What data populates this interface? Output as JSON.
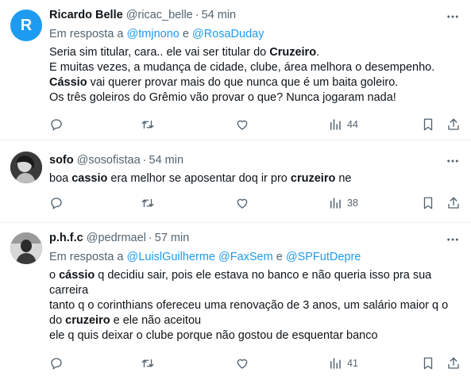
{
  "tweets": [
    {
      "avatar_letter": "R",
      "name": "Ricardo Belle",
      "handle": "@ricac_belle",
      "time": "54 min",
      "reply_prefix": "Em resposta a",
      "reply_mentions": [
        "@tmjnono",
        "@RosaDuday"
      ],
      "reply_joiner": "e",
      "lines": [
        [
          "Seria sim titular, cara.. ele vai ser titular do ",
          "Cruzeiro",
          "."
        ],
        [
          "E muitas vezes, a mudança de cidade, clube, área melhora o desempenho."
        ],
        [
          "",
          "Cássio",
          " vai querer provar mais do que nunca que é um baita goleiro."
        ],
        [
          "Os três goleiros do Grêmio vão provar o que? Nunca jogaram nada!"
        ]
      ],
      "views": "44"
    },
    {
      "name": "sofo",
      "handle": "@sosofistaa",
      "time": "54 min",
      "lines": [
        [
          "boa ",
          "cassio",
          " era melhor se aposentar doq ir pro ",
          "cruzeiro",
          " ne"
        ]
      ],
      "views": "38"
    },
    {
      "name": "p.h.f.c",
      "handle": "@pedrmael",
      "time": "57 min",
      "reply_prefix": "Em resposta a",
      "reply_mentions": [
        "@LuislGuilherme",
        "@FaxSem",
        "@SPFutDepre"
      ],
      "reply_joiner": "e",
      "lines": [
        [
          "o ",
          "cássio",
          " q decidiu sair, pois ele estava no banco e não queria isso pra sua"
        ],
        [
          "carreira"
        ],
        [
          "tanto q o corinthians ofereceu uma renovação de 3 anos, um salário maior q o"
        ],
        [
          "do ",
          "cruzeiro",
          " e ele não aceitou"
        ],
        [
          "ele q quis deixar o clube porque não gostou de esquentar banco"
        ]
      ],
      "views": "41"
    }
  ],
  "dot": "·"
}
